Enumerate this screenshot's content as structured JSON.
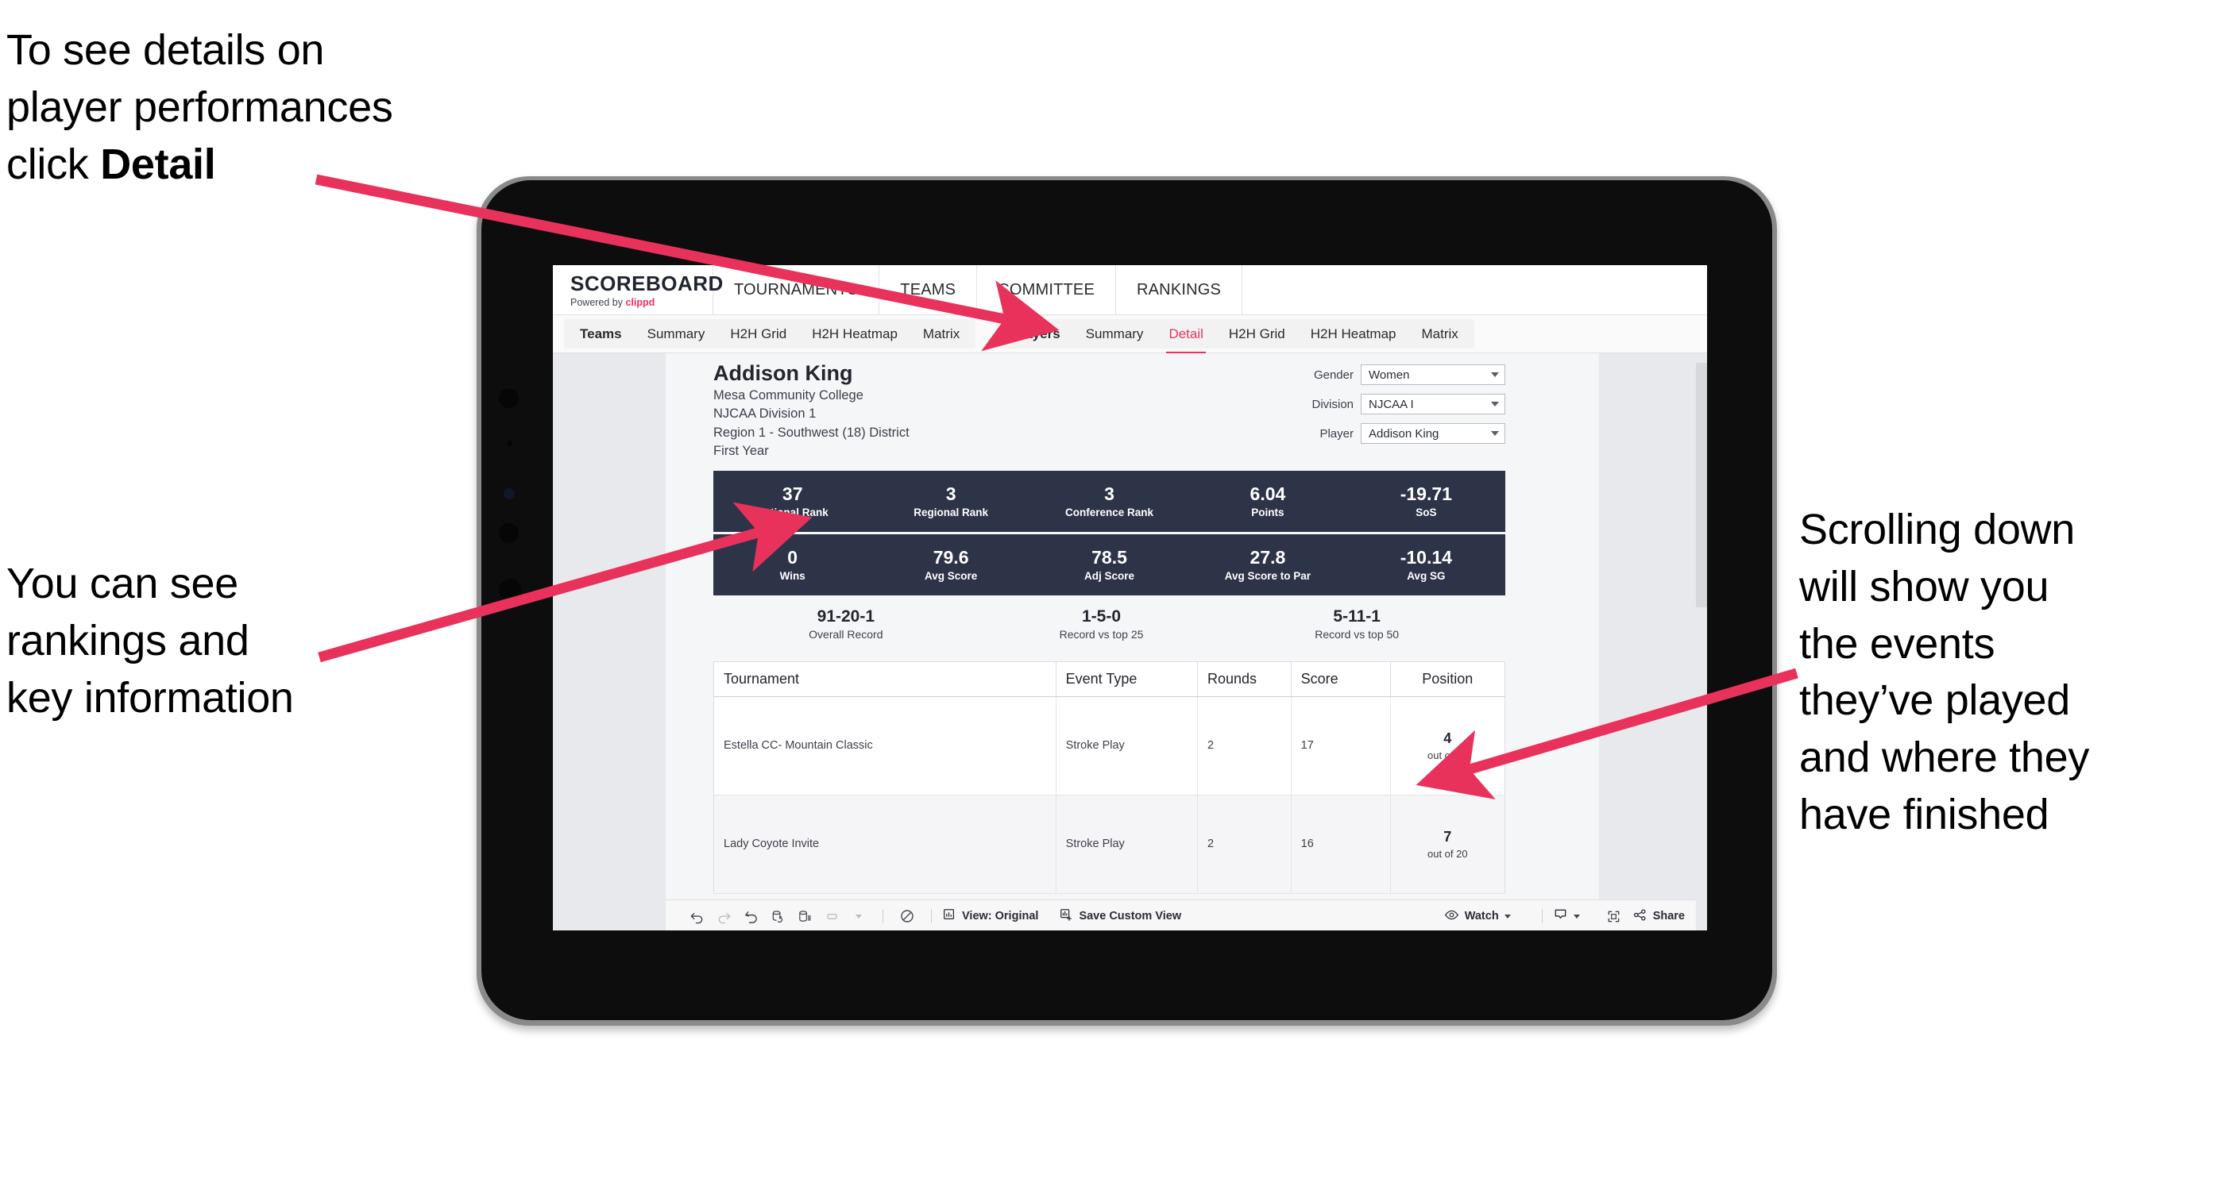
{
  "annotations": {
    "detail": {
      "line1": "To see details on",
      "line2": "player performances",
      "line3_pre": "click ",
      "line3_bold": "Detail"
    },
    "rankings": {
      "line1": "You can see",
      "line2": "rankings and",
      "line3": "key information"
    },
    "scroll": {
      "line1": "Scrolling down",
      "line2": "will show you",
      "line3": "the events",
      "line4": "they’ve played",
      "line5": "and where they",
      "line6": "have finished"
    },
    "arrow_color": "#e8325c"
  },
  "app": {
    "logo": {
      "main": "SCOREBOARD",
      "sub_prefix": "Powered by ",
      "sub_brand": "clippd"
    },
    "top_nav": [
      {
        "label": "TOURNAMENTS"
      },
      {
        "label": "TEAMS"
      },
      {
        "label": "COMMITTEE"
      },
      {
        "label": "RANKINGS"
      }
    ],
    "sub_nav": {
      "group_teams": [
        {
          "label": "Teams",
          "strong": true
        },
        {
          "label": "Summary"
        },
        {
          "label": "H2H Grid"
        },
        {
          "label": "H2H Heatmap"
        },
        {
          "label": "Matrix"
        }
      ],
      "group_players": [
        {
          "label": "Players",
          "strong": true
        },
        {
          "label": "Summary"
        },
        {
          "label": "Detail",
          "active": true
        },
        {
          "label": "H2H Grid"
        },
        {
          "label": "H2H Heatmap"
        },
        {
          "label": "Matrix"
        }
      ],
      "active_color": "#e4365c"
    }
  },
  "player": {
    "name": "Addison King",
    "school": "Mesa Community College",
    "division": "NJCAA Division 1",
    "region": "Region 1 - Southwest (18) District",
    "year": "First Year"
  },
  "filters": [
    {
      "label": "Gender",
      "value": "Women"
    },
    {
      "label": "Division",
      "value": "NJCAA I"
    },
    {
      "label": "Player",
      "value": "Addison King"
    }
  ],
  "stat_band_1": [
    {
      "value": "37",
      "label": "National Rank"
    },
    {
      "value": "3",
      "label": "Regional Rank"
    },
    {
      "value": "3",
      "label": "Conference Rank"
    },
    {
      "value": "6.04",
      "label": "Points"
    },
    {
      "value": "-19.71",
      "label": "SoS"
    }
  ],
  "stat_band_2": [
    {
      "value": "0",
      "label": "Wins"
    },
    {
      "value": "79.6",
      "label": "Avg Score"
    },
    {
      "value": "78.5",
      "label": "Adj Score"
    },
    {
      "value": "27.8",
      "label": "Avg Score to Par"
    },
    {
      "value": "-10.14",
      "label": "Avg SG"
    }
  ],
  "records": [
    {
      "value": "91-20-1",
      "label": "Overall Record"
    },
    {
      "value": "1-5-0",
      "label": "Record vs top 25"
    },
    {
      "value": "5-11-1",
      "label": "Record vs top 50"
    }
  ],
  "events_table": {
    "columns": [
      "Tournament",
      "Event Type",
      "Rounds",
      "Score",
      "Position"
    ],
    "rows": [
      {
        "tournament": "Estella CC- Mountain Classic",
        "event_type": "Stroke Play",
        "rounds": "2",
        "score": "17",
        "position_value": "4",
        "position_sub": "out of 20"
      },
      {
        "tournament": "Lady Coyote Invite",
        "event_type": "Stroke Play",
        "rounds": "2",
        "score": "16",
        "position_value": "7",
        "position_sub": "out of 20"
      }
    ]
  },
  "toolbar": {
    "view_label": "View: Original",
    "save_label": "Save Custom View",
    "watch_label": "Watch",
    "share_label": "Share"
  },
  "colors": {
    "band": "#2e3448",
    "accent": "#e4365c",
    "page_bg": "#e8e9ec"
  }
}
